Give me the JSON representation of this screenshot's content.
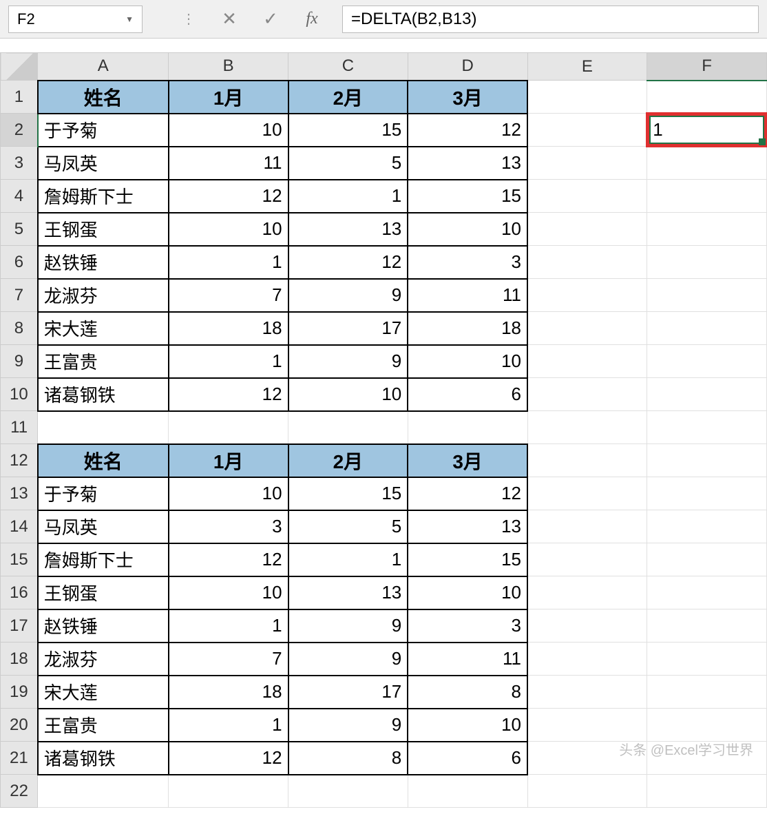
{
  "name_box": "F2",
  "formula": "=DELTA(B2,B13)",
  "fx_label": "fx",
  "columns": [
    "A",
    "B",
    "C",
    "D",
    "E",
    "F"
  ],
  "active_col": "F",
  "active_row": 2,
  "selected_value": "1",
  "headers": {
    "name": "姓名",
    "m1": "1月",
    "m2": "2月",
    "m3": "3月"
  },
  "table1": [
    {
      "name": "于予菊",
      "m1": "10",
      "m2": "15",
      "m3": "12"
    },
    {
      "name": "马凤英",
      "m1": "11",
      "m2": "5",
      "m3": "13"
    },
    {
      "name": "詹姆斯下士",
      "m1": "12",
      "m2": "1",
      "m3": "15"
    },
    {
      "name": "王钢蛋",
      "m1": "10",
      "m2": "13",
      "m3": "10"
    },
    {
      "name": "赵铁锤",
      "m1": "1",
      "m2": "12",
      "m3": "3"
    },
    {
      "name": "龙淑芬",
      "m1": "7",
      "m2": "9",
      "m3": "11"
    },
    {
      "name": "宋大莲",
      "m1": "18",
      "m2": "17",
      "m3": "18"
    },
    {
      "name": "王富贵",
      "m1": "1",
      "m2": "9",
      "m3": "10"
    },
    {
      "name": "诸葛钢铁",
      "m1": "12",
      "m2": "10",
      "m3": "6"
    }
  ],
  "table2": [
    {
      "name": "于予菊",
      "m1": "10",
      "m2": "15",
      "m3": "12"
    },
    {
      "name": "马凤英",
      "m1": "3",
      "m2": "5",
      "m3": "13"
    },
    {
      "name": "詹姆斯下士",
      "m1": "12",
      "m2": "1",
      "m3": "15"
    },
    {
      "name": "王钢蛋",
      "m1": "10",
      "m2": "13",
      "m3": "10"
    },
    {
      "name": "赵铁锤",
      "m1": "1",
      "m2": "9",
      "m3": "3"
    },
    {
      "name": "龙淑芬",
      "m1": "7",
      "m2": "9",
      "m3": "11"
    },
    {
      "name": "宋大莲",
      "m1": "18",
      "m2": "17",
      "m3": "8"
    },
    {
      "name": "王富贵",
      "m1": "1",
      "m2": "9",
      "m3": "10"
    },
    {
      "name": "诸葛钢铁",
      "m1": "12",
      "m2": "8",
      "m3": "6"
    }
  ],
  "watermark": "头条 @Excel学习世界"
}
